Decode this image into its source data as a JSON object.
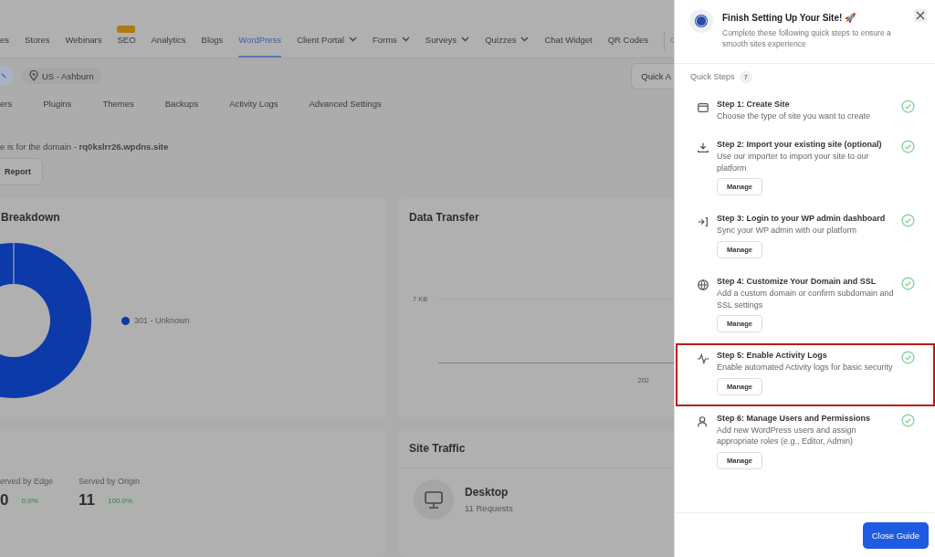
{
  "nav": [
    {
      "label": "es",
      "selected": false,
      "dropdown": false,
      "badge": false
    },
    {
      "label": "Stores",
      "selected": false,
      "dropdown": false,
      "badge": false
    },
    {
      "label": "Webinars",
      "selected": false,
      "dropdown": false,
      "badge": false
    },
    {
      "label": "SEO",
      "selected": false,
      "dropdown": false,
      "badge": true
    },
    {
      "label": "Analytics",
      "selected": false,
      "dropdown": false,
      "badge": false
    },
    {
      "label": "Blogs",
      "selected": false,
      "dropdown": false,
      "badge": false
    },
    {
      "label": "WordPress",
      "selected": true,
      "dropdown": false,
      "badge": false
    },
    {
      "label": "Client Portal",
      "selected": false,
      "dropdown": true,
      "badge": false
    },
    {
      "label": "Forms",
      "selected": false,
      "dropdown": true,
      "badge": false
    },
    {
      "label": "Surveys",
      "selected": false,
      "dropdown": true,
      "badge": false
    },
    {
      "label": "Quizzes",
      "selected": false,
      "dropdown": true,
      "badge": false
    },
    {
      "label": "Chat Widget",
      "selected": false,
      "dropdown": false,
      "badge": false
    },
    {
      "label": "QR Codes",
      "selected": false,
      "dropdown": false,
      "badge": false
    }
  ],
  "location": "US - Ashburn",
  "quick_button": "Quick A",
  "subtabs": [
    "ers",
    "Plugins",
    "Themes",
    "Backups",
    "Activity Logs",
    "Advanced Settings"
  ],
  "domain_note": "e is for the domain - **rq0kslrr26.wpdns.site**",
  "report_button": "Report",
  "breakdown": {
    "title": "Breakdown",
    "legend": [
      "301 - Unknown"
    ]
  },
  "data_transfer": {
    "title": "Data Transfer",
    "y_label": "7 KB",
    "x_label": "202"
  },
  "served": [
    {
      "label": "erved by Edge",
      "value": "0",
      "percent": "0.0%"
    },
    {
      "label": "Served by Origin",
      "value": "11",
      "percent": "100.0%"
    }
  ],
  "site_traffic": {
    "title": "Site Traffic",
    "device": "Desktop",
    "requests": "11 Requests"
  },
  "guide": {
    "title": "Finish Setting Up Your Site! 🚀",
    "subtitle": "Complete these following quick steps to ensure a smooth sites experience",
    "steps_label": "Quick Steps",
    "steps_count": "7",
    "close_button": "Close Guide",
    "steps": [
      {
        "kind": "browser",
        "title": "Step 1: Create Site",
        "description": "Choose the type of site you want to create",
        "done": true,
        "highlighted": false
      },
      {
        "kind": "download",
        "title": "Step 2: Import your existing site (optional)",
        "description": "Use our importer to import your site to our platform",
        "button": "Manage",
        "done": true,
        "highlighted": false
      },
      {
        "kind": "login",
        "title": "Step 3: Login to your WP admin dashboard",
        "description": "Sync your WP admin with our platform",
        "button": "Manage",
        "done": true,
        "highlighted": false
      },
      {
        "kind": "globe",
        "title": "Step 4: Customize Your Domain and SSL",
        "description": "Add a custom domain or confirm subdomain and SSL settings",
        "button": "Manage",
        "done": true,
        "highlighted": false
      },
      {
        "kind": "activity",
        "title": "Step 5: Enable Activity Logs",
        "description": "Enable automated Activity logs for basic security",
        "button": "Manage",
        "done": true,
        "highlighted": true
      },
      {
        "kind": "user",
        "title": "Step 6: Manage Users and Permissions",
        "description": "Add new WordPress users and assign appropriate roles (e.g., Editor, Admin)",
        "button": "Manage",
        "done": true,
        "highlighted": false
      }
    ]
  }
}
